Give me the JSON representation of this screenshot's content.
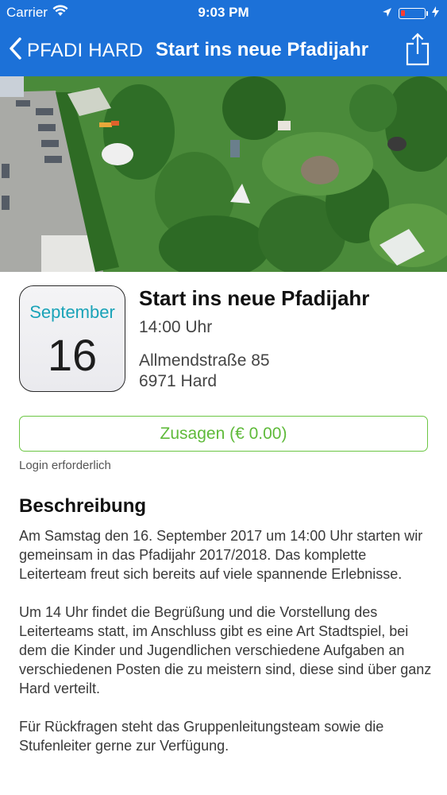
{
  "status_bar": {
    "carrier": "Carrier",
    "time": "9:03 PM"
  },
  "nav": {
    "back_label": "PFADI HARD",
    "title": "Start ins neue Pfadijahr"
  },
  "event": {
    "month": "September",
    "day": "16",
    "title": "Start ins neue Pfadijahr",
    "time": "14:00 Uhr",
    "address_line1": "Allmendstraße 85",
    "address_line2": "6971 Hard"
  },
  "rsvp": {
    "button_label": "Zusagen (€ 0.00)",
    "note": "Login erforderlich"
  },
  "description": {
    "heading": "Beschreibung",
    "paragraphs": [
      "Am Samstag den 16. September 2017 um 14:00 Uhr starten wir gemeinsam in das Pfadijahr 2017/2018. Das komplette Leiterteam freut sich bereits auf viele spannende Erlebnisse.",
      "Um 14 Uhr findet die Begrüßung und die Vorstellung des Leiterteams statt, im Anschluss gibt es eine Art Stadtspiel, bei dem die Kinder und Jugendlichen verschiedene Aufgaben an verschiedenen Posten die zu meistern sind, diese sind über ganz Hard verteilt.",
      "Für Rückfragen steht das Gruppenleitungsteam sowie die Stufenleiter gerne zur Verfügung."
    ]
  },
  "colors": {
    "nav_background": "#1c71d8",
    "month_accent": "#1aa3b8",
    "rsvp_green": "#6cc644",
    "battery_low": "#ff3b30"
  },
  "icons": [
    "wifi-icon",
    "back-chevron-icon",
    "share-icon",
    "location-arrow-icon",
    "battery-icon",
    "charging-icon"
  ]
}
